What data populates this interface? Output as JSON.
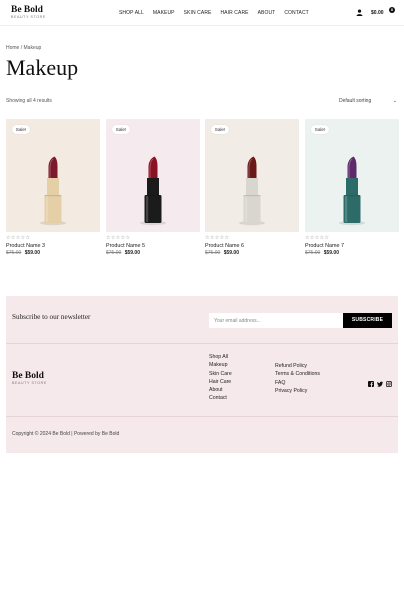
{
  "header": {
    "logo_name": "Be Bold",
    "logo_tag": "BEAUTY STORE",
    "nav": [
      "SHOP ALL",
      "MAKEUP",
      "SKIN CARE",
      "HAIR CARE",
      "ABOUT",
      "CONTACT"
    ],
    "cart_total": "$0.00",
    "cart_count": "0"
  },
  "breadcrumb": "Home / Makeup",
  "page_title": "Makeup",
  "results_text": "Showing all 4 results",
  "sorting_label": "Default sorting",
  "products": [
    {
      "name": "Product Name 3",
      "sale": "Sale!",
      "stars": "☆☆☆☆☆",
      "old_price": "$75.00",
      "new_price": "$59.00",
      "bg": "#f3ebe1",
      "tube": "#e4cfa6",
      "bullet": "#7a1a2c"
    },
    {
      "name": "Product Name 5",
      "sale": "Sale!",
      "stars": "☆☆☆☆☆",
      "old_price": "$75.00",
      "new_price": "$59.00",
      "bg": "#f5ebee",
      "tube": "#1b1b1b",
      "bullet": "#8a1222"
    },
    {
      "name": "Product Name 6",
      "sale": "Sale!",
      "stars": "☆☆☆☆☆",
      "old_price": "$75.00",
      "new_price": "$59.00",
      "bg": "#f1ece6",
      "tube": "#d9d6cf",
      "bullet": "#6b1818"
    },
    {
      "name": "Product Name 7",
      "sale": "Sale!",
      "stars": "☆☆☆☆☆",
      "old_price": "$75.00",
      "new_price": "$59.00",
      "bg": "#ecf2f0",
      "tube": "#2c6b68",
      "bullet": "#5d2a6a"
    }
  ],
  "newsletter": {
    "title": "Subscribe to our newsletter",
    "placeholder": "Your email address...",
    "button": "SUBSCRIBE"
  },
  "footer": {
    "logo_name": "Be Bold",
    "logo_tag": "BEAUTY STORE",
    "links_col1": [
      "Shop All",
      "Makeup",
      "Skin Care",
      "Hair Care",
      "About",
      "Contact"
    ],
    "links_col2": [
      "Refund Policy",
      "Terms & Conditions",
      "FAQ",
      "Privacy Policy"
    ],
    "social": [
      "facebook-icon",
      "twitter-icon",
      "instagram-icon"
    ],
    "copyright": "Copyright © 2024 Be Bold | Powered by Be Bold"
  }
}
